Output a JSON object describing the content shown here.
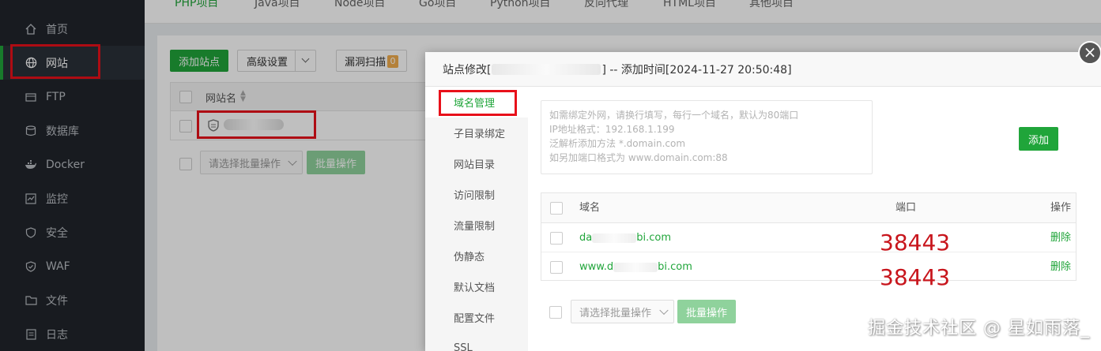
{
  "sidebar": {
    "items": [
      {
        "label": "首页",
        "icon": "home-icon"
      },
      {
        "label": "网站",
        "icon": "globe-icon"
      },
      {
        "label": "FTP",
        "icon": "ftp-icon"
      },
      {
        "label": "数据库",
        "icon": "database-icon"
      },
      {
        "label": "Docker",
        "icon": "docker-icon"
      },
      {
        "label": "监控",
        "icon": "monitor-icon"
      },
      {
        "label": "安全",
        "icon": "shield-icon"
      },
      {
        "label": "WAF",
        "icon": "waf-icon"
      },
      {
        "label": "文件",
        "icon": "folder-icon"
      },
      {
        "label": "日志",
        "icon": "log-icon"
      }
    ]
  },
  "tabs": [
    "PHP项目",
    "Java项目",
    "Node项目",
    "Go项目",
    "Python项目",
    "反向代理",
    "HTML项目",
    "其他项目"
  ],
  "toolbar": {
    "add_site": "添加站点",
    "advanced": "高级设置",
    "vuln_scan": "漏洞扫描",
    "vuln_count": "0"
  },
  "site_table": {
    "col_name": "网站名",
    "batch_placeholder": "请选择批量操作",
    "batch_button": "批量操作"
  },
  "modal": {
    "title_prefix": "站点修改[",
    "title_suffix": "] -- 添加时间[2024-11-27 20:50:48]",
    "menu": [
      "域名管理",
      "子目录绑定",
      "网站目录",
      "访问限制",
      "流量限制",
      "伪静态",
      "默认文档",
      "配置文件",
      "SSL"
    ],
    "domain_input_hint": [
      "如需绑定外网，请换行填写，每行一个域名，默认为80端口",
      "IP地址格式：192.168.1.199",
      "泛解析添加方法 *.domain.com",
      "如另加端口格式为 www.domain.com:88"
    ],
    "add_button": "添加",
    "table": {
      "col_domain": "域名",
      "col_port": "端口",
      "col_action": "操作",
      "rows": [
        {
          "domain_start": "da",
          "domain_end": "bi.com",
          "port": "38443",
          "action": "删除"
        },
        {
          "domain_start": "www.d",
          "domain_end": "bi.com",
          "port": "38443",
          "action": "删除"
        }
      ]
    },
    "batch_placeholder": "请选择批量操作",
    "batch_button": "批量操作"
  },
  "watermark": "掘金技术社区 @ 星如雨落_",
  "colors": {
    "accent": "#20a53a",
    "highlight": "#e8101a",
    "sidebar_bg": "#20252b"
  }
}
